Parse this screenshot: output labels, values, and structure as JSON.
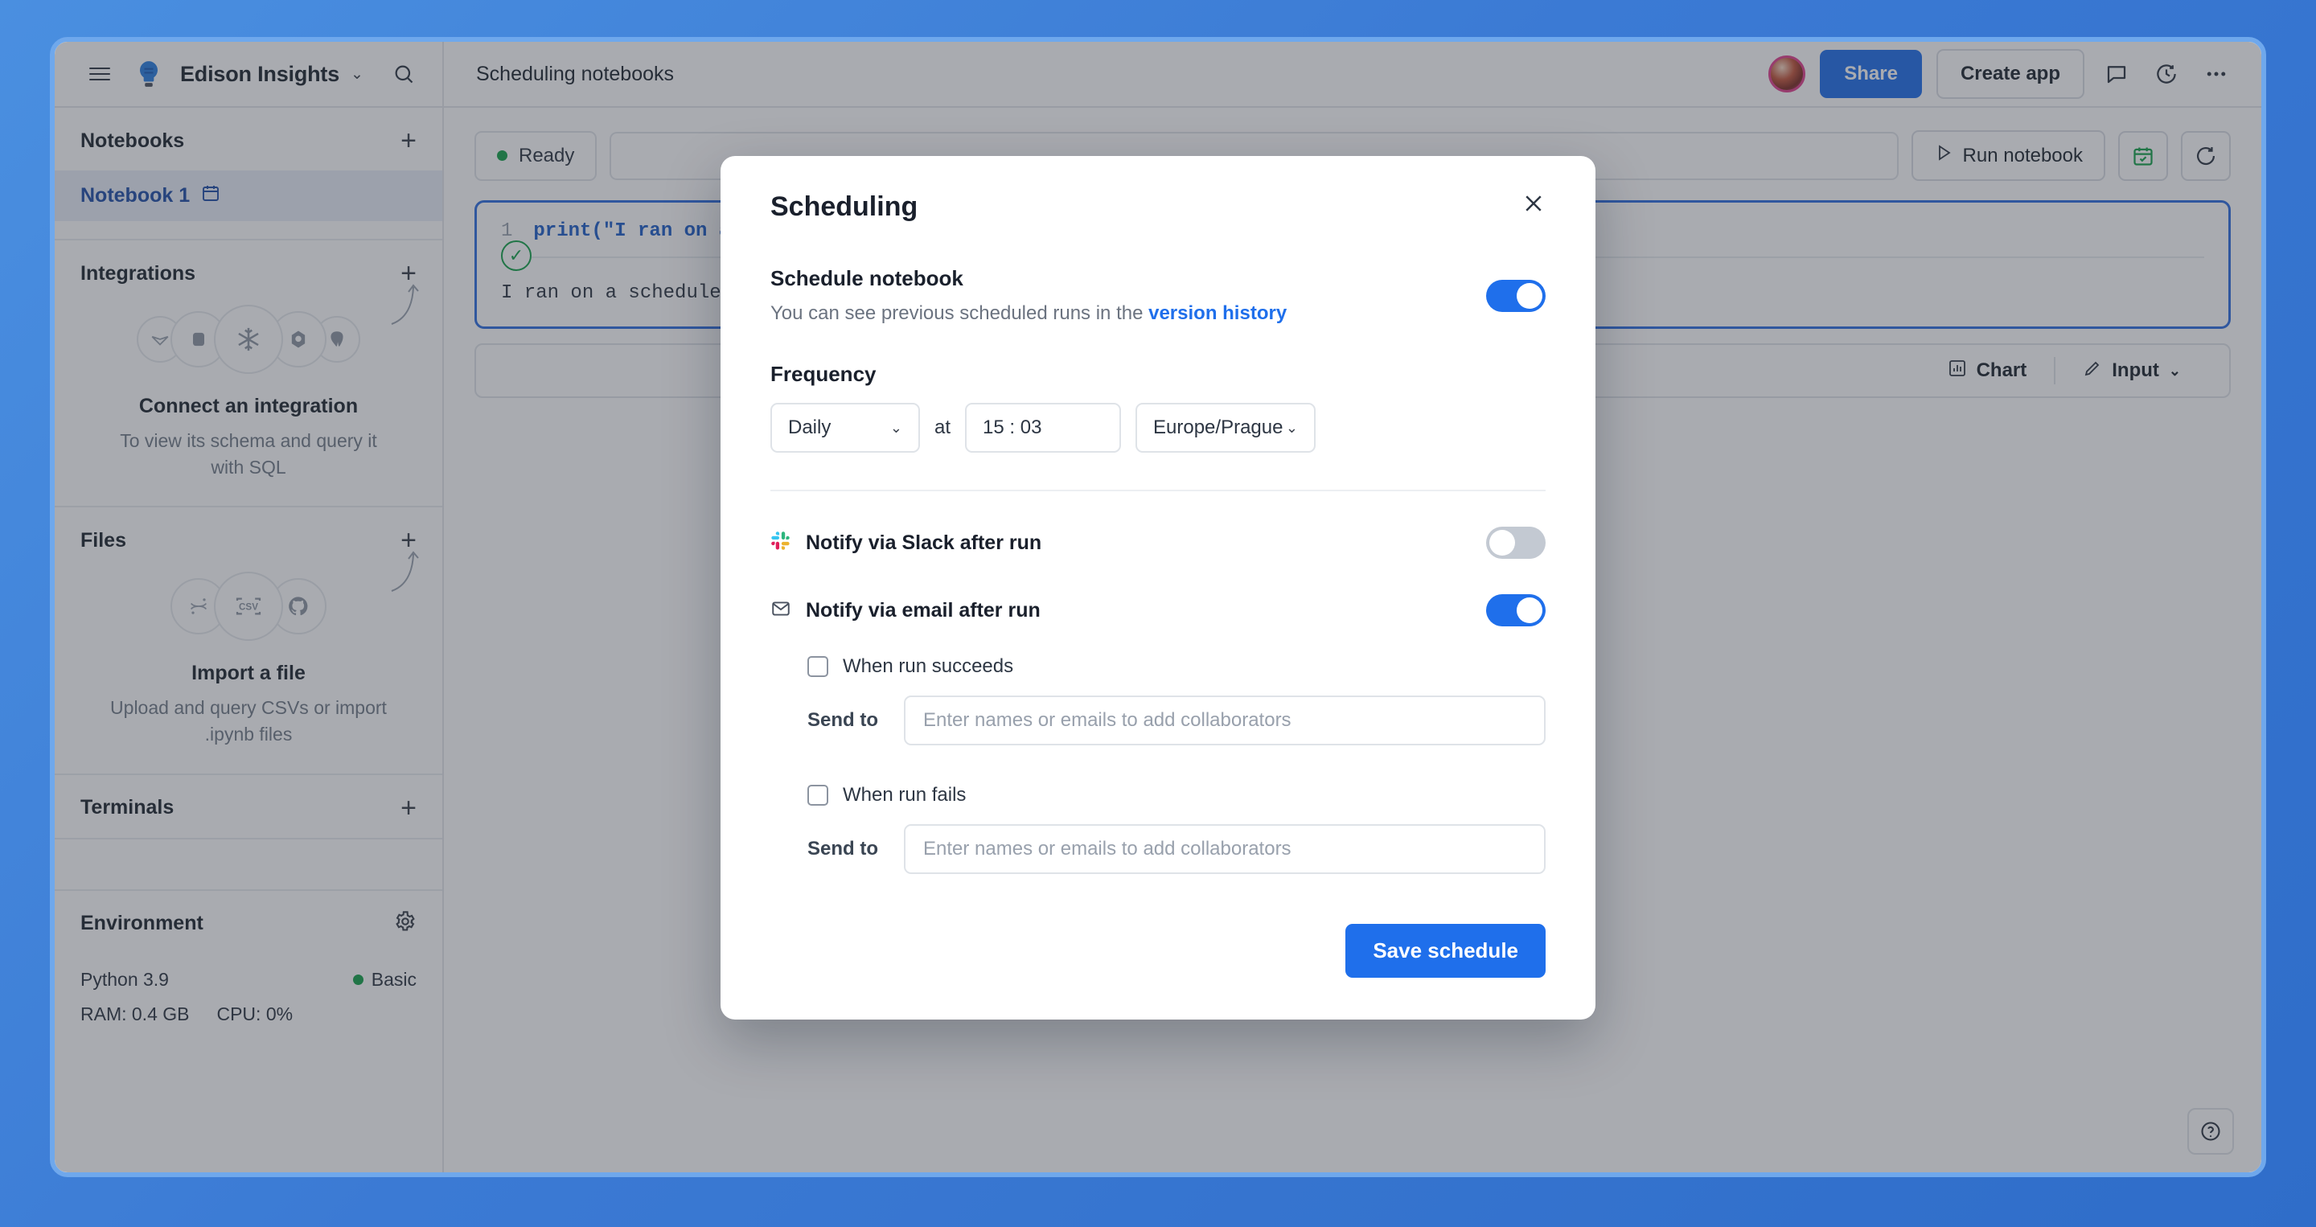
{
  "topbar": {
    "menu_icon": "hamburger-menu-icon",
    "logo_icon": "lightbulb-logo-icon",
    "workspace": "Edison Insights",
    "workspace_chevron": "⌄",
    "search_icon": "search-icon",
    "breadcrumb": "Scheduling notebooks",
    "share_label": "Share",
    "create_app_label": "Create app",
    "comment_icon": "comment-icon",
    "history_icon": "clock-history-icon",
    "more_icon": "more-horizontal-icon"
  },
  "sidebar": {
    "notebooks": {
      "title": "Notebooks",
      "add_icon": "plus-icon",
      "items": [
        {
          "label": "Notebook 1",
          "icon": "calendar-schedule-icon"
        }
      ]
    },
    "integrations": {
      "title": "Integrations",
      "add_icon": "plus-icon",
      "empty_title": "Connect an integration",
      "empty_sub": "To view its schema and query it with SQL",
      "icons": [
        "athena-icon",
        "database-icon",
        "snowflake-icon",
        "bigquery-icon",
        "postgresql-icon"
      ]
    },
    "files": {
      "title": "Files",
      "add_icon": "plus-icon",
      "empty_title": "Import a file",
      "empty_sub": "Upload and query CSVs or import .ipynb files",
      "icons": [
        "jupyter-icon",
        "csv-icon",
        "github-icon"
      ]
    },
    "terminals": {
      "title": "Terminals",
      "add_icon": "plus-icon"
    },
    "environment": {
      "title": "Environment",
      "settings_icon": "gear-icon",
      "runtime": "Python 3.9",
      "plan": "Basic",
      "plan_color": "#16a34a",
      "ram": "RAM: 0.4 GB",
      "cpu": "CPU: 0%"
    }
  },
  "main": {
    "status": "Ready",
    "status_color": "#16a34a",
    "run_notebook_label": "Run notebook",
    "run_icon": "play-icon",
    "schedule_icon": "calendar-check-icon",
    "refresh_icon": "refresh-icon",
    "cell": {
      "line_number": "1",
      "code": "print(\"I ran on a schedule\")",
      "code_keyword": "print",
      "status_icon": "check-circle-icon",
      "output": "I ran on a schedule"
    },
    "footer": {
      "chart_label": "Chart",
      "chart_icon": "bar-chart-icon",
      "input_label": "Input",
      "input_icon": "pencil-icon",
      "input_chevron": "⌄"
    },
    "help_icon": "question-circle-icon"
  },
  "modal": {
    "title": "Scheduling",
    "close_icon": "close-icon",
    "schedule": {
      "title": "Schedule notebook",
      "subtitle_prefix": "You can see previous scheduled runs in the ",
      "subtitle_link": "version history",
      "enabled": true
    },
    "frequency": {
      "label": "Frequency",
      "value": "Daily",
      "chevron": "⌄",
      "at_label": "at",
      "time": "15 : 03",
      "timezone": "Europe/Prague",
      "tz_chevron": "⌄"
    },
    "slack": {
      "icon": "slack-icon",
      "label": "Notify via Slack after run",
      "enabled": false
    },
    "email": {
      "icon": "envelope-icon",
      "label": "Notify via email after run",
      "enabled": true,
      "success": {
        "checkbox_label": "When run succeeds",
        "checked": false,
        "sendto_label": "Send to",
        "sendto_placeholder": "Enter names or emails to add collaborators",
        "sendto_value": ""
      },
      "failure": {
        "checkbox_label": "When run fails",
        "checked": false,
        "sendto_label": "Send to",
        "sendto_placeholder": "Enter names or emails to add collaborators",
        "sendto_value": ""
      }
    },
    "save_label": "Save schedule"
  },
  "colors": {
    "accent_blue": "#1f6feb",
    "page_background": "#3b7ad4",
    "frame_border": "#6fa8ec",
    "cell_border": "#2f6fe0"
  }
}
